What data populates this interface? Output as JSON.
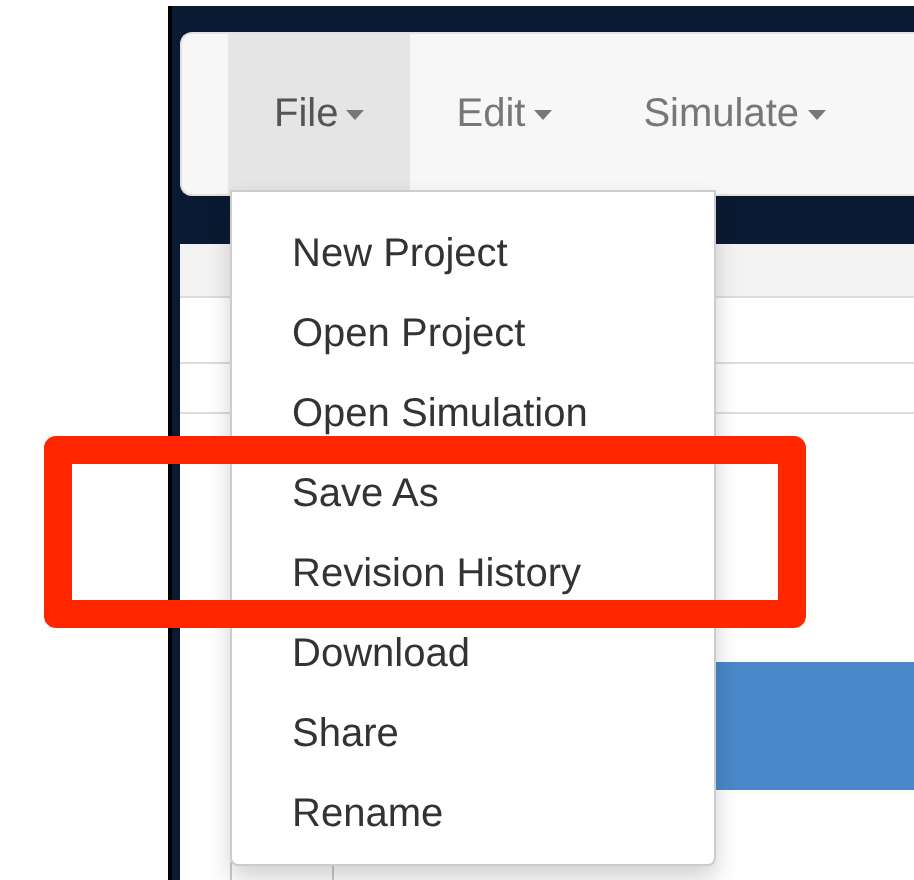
{
  "menubar": [
    {
      "label": "File",
      "selected": true
    },
    {
      "label": "Edit",
      "selected": false
    },
    {
      "label": "Simulate",
      "selected": false
    }
  ],
  "dropdown": {
    "items": [
      {
        "label": "New Project"
      },
      {
        "label": "Open Project"
      },
      {
        "label": "Open Simulation"
      },
      {
        "label": "Save As"
      },
      {
        "label": "Revision History"
      },
      {
        "label": "Download"
      },
      {
        "label": "Share"
      },
      {
        "label": "Rename"
      }
    ]
  }
}
